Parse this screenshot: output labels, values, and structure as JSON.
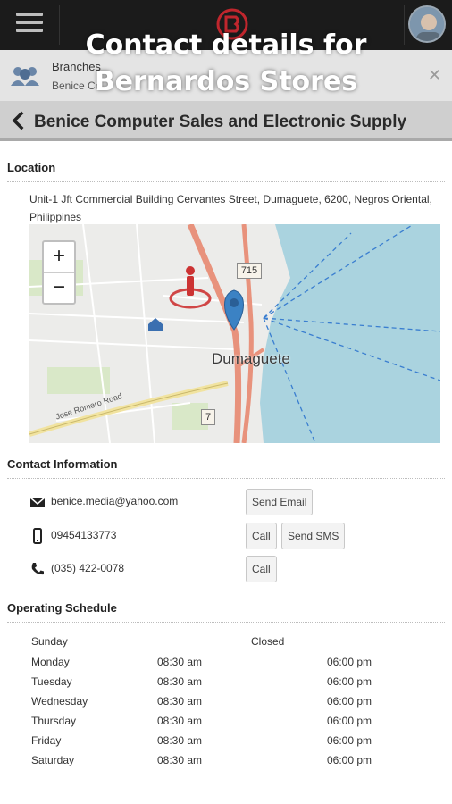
{
  "overlay": {
    "line1": "Contact details for",
    "line2": "Bernardos Stores"
  },
  "branch_bar": {
    "title": "Branches",
    "subtitle": "Benice Co"
  },
  "header": {
    "title": "Benice Computer Sales and Electronic Supply"
  },
  "location": {
    "section_title": "Location",
    "address": "Unit-1 Jft Commercial Building Cervantes Street, Dumaguete, 6200, Negros Oriental, Philippines",
    "map": {
      "city_label": "Dumaguete",
      "road_number_1": "715",
      "road_number_2": "7",
      "road_name": "Jose Romero Road",
      "zoom_in": "+",
      "zoom_out": "−"
    }
  },
  "contact": {
    "section_title": "Contact Information",
    "email": {
      "icon": "envelope-icon",
      "value": "benice.media@yahoo.com",
      "button": "Send Email"
    },
    "mobile": {
      "icon": "mobile-phone-icon",
      "value": "09454133773",
      "call_button": "Call",
      "sms_button": "Send SMS"
    },
    "landline": {
      "icon": "phone-icon",
      "value": "(035) 422-0078",
      "call_button": "Call"
    }
  },
  "schedule": {
    "section_title": "Operating Schedule",
    "rows": [
      {
        "day": "Sunday",
        "status": "Closed"
      },
      {
        "day": "Monday",
        "open": "08:30 am",
        "close": "06:00 pm"
      },
      {
        "day": "Tuesday",
        "open": "08:30 am",
        "close": "06:00 pm"
      },
      {
        "day": "Wednesday",
        "open": "08:30 am",
        "close": "06:00 pm"
      },
      {
        "day": "Thursday",
        "open": "08:30 am",
        "close": "06:00 pm"
      },
      {
        "day": "Friday",
        "open": "08:30 am",
        "close": "06:00 pm"
      },
      {
        "day": "Saturday",
        "open": "08:30 am",
        "close": "06:00 pm"
      }
    ]
  },
  "colors": {
    "top_bar": "#1b1b1b",
    "header_bar": "#cfcfcf",
    "map_water": "#aad3df",
    "map_road": "#e8927c",
    "pin": "#3b82c4",
    "logo_red": "#c0262d"
  }
}
